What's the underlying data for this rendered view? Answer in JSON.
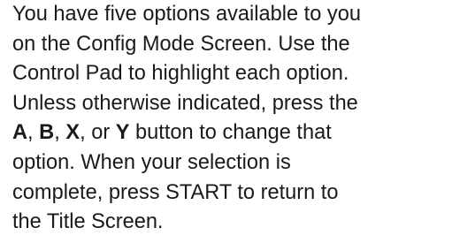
{
  "paragraph": {
    "line1": "You have five options available to you",
    "line2": "on the Config Mode Screen.  Use the",
    "line3": "Control Pad to highlight each option.",
    "line4": "Unless otherwise indicated, press the",
    "line5": {
      "btn_a": "A",
      "sep1": ", ",
      "btn_b": "B",
      "sep2": ", ",
      "btn_x": "X",
      "sep3": ", or ",
      "btn_y": "Y",
      "rest": " button to change that"
    },
    "line6": "option.  When your selection is",
    "line7": "complete, press START to return to",
    "line8": "the Title Screen."
  }
}
